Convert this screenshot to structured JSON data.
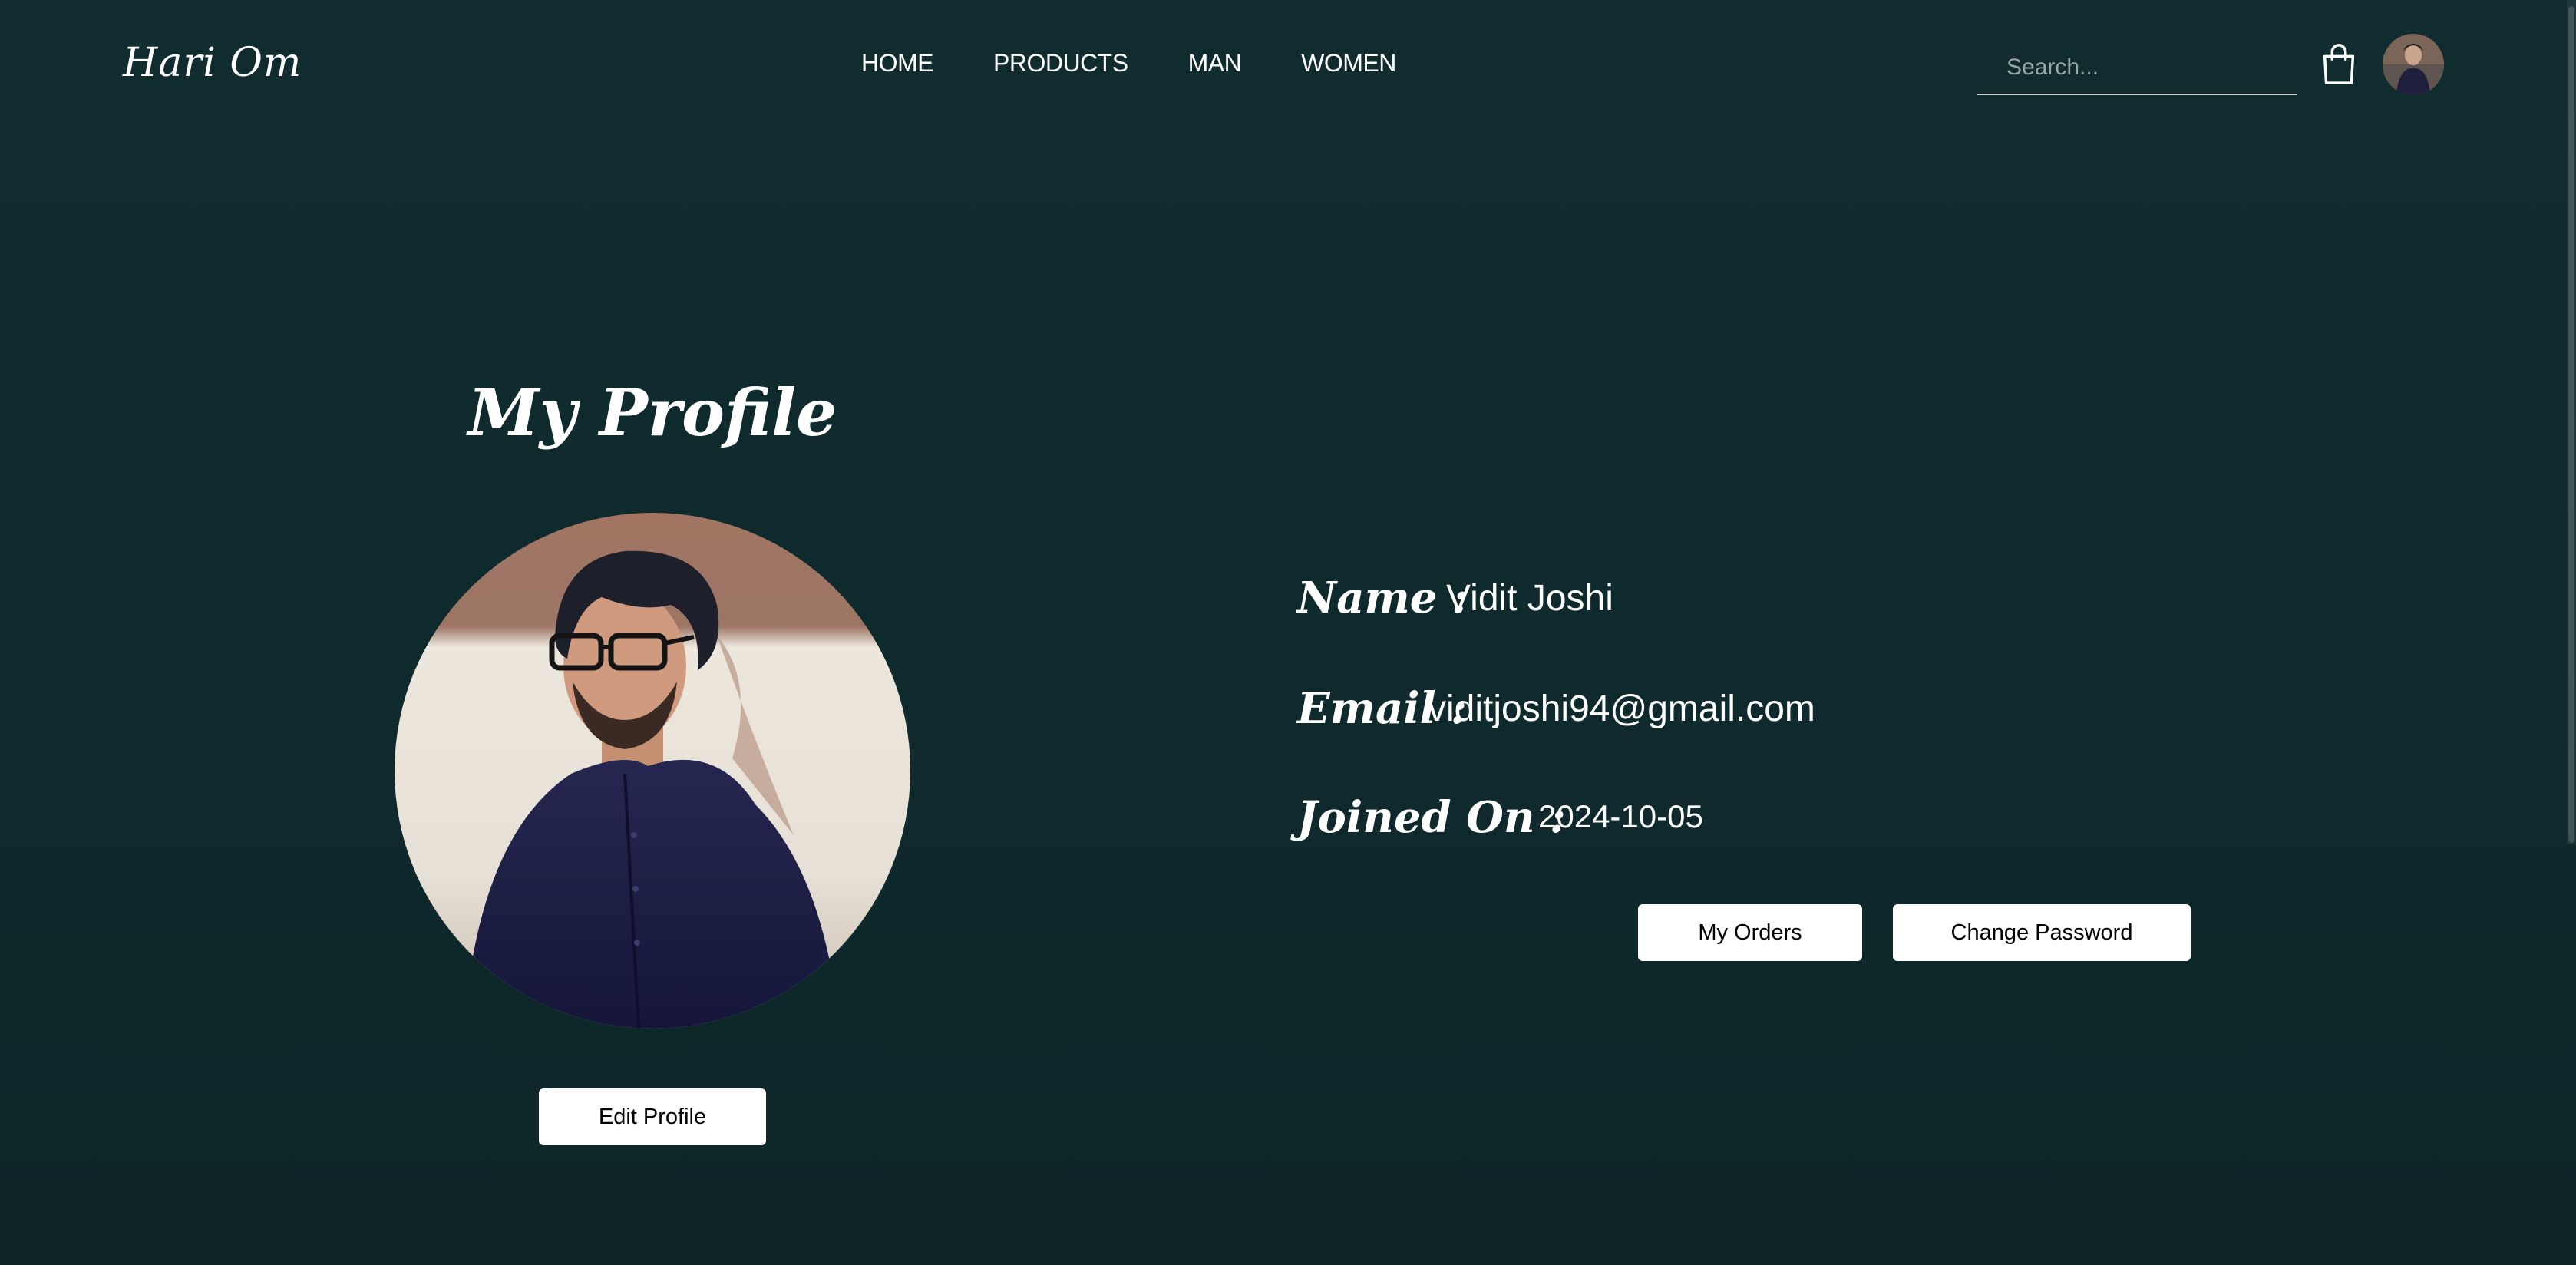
{
  "header": {
    "brand": "Hari Om",
    "nav": [
      {
        "label": "HOME"
      },
      {
        "label": "PRODUCTS"
      },
      {
        "label": "MAN"
      },
      {
        "label": "WOMEN"
      }
    ],
    "search": {
      "placeholder": "Search...",
      "value": ""
    },
    "icons": {
      "search": "search-icon",
      "cart": "shopping-bag-icon",
      "avatar": "user-avatar"
    }
  },
  "profile": {
    "title": "My Profile",
    "edit_button": "Edit Profile",
    "fields": {
      "name_label": "Name :",
      "name_value": "Vidit Joshi",
      "email_label": "Email :",
      "email_value": "viditjoshi94@gmail.com",
      "joined_label": "Joined On :",
      "joined_value": "2024-10-05"
    },
    "buttons": {
      "orders": "My Orders",
      "change_password": "Change Password"
    }
  },
  "colors": {
    "background": "#0f2b2e",
    "text": "#ffffff",
    "button_bg": "#ffffff",
    "button_text": "#000000"
  }
}
